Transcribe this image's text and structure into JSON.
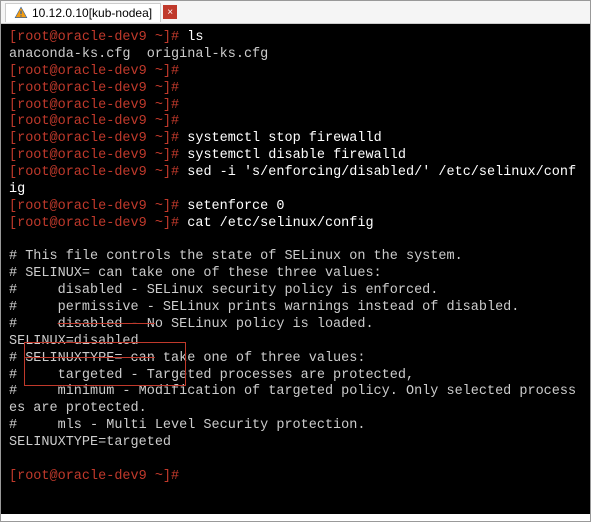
{
  "tab": {
    "title": "10.12.0.10[kub-nodea]",
    "close": "×"
  },
  "term": {
    "p1": "[root@oracle-dev9 ~]#",
    "ls": "ls",
    "lsout": "anaconda-ks.cfg  original-ks.cfg",
    "stop": "systemctl stop firewalld",
    "disable": "systemctl disable firewalld",
    "sed": "sed -i 's/enforcing/disabled/' /etc/selinux/config",
    "setenforce": "setenforce 0",
    "cat": "cat /etc/selinux/config",
    "cfg1": "# This file controls the state of SELinux on the system.",
    "cfg2": "# SELINUX= can take one of these three values:",
    "cfg3": "#     disabled - SELinux security policy is enforced.",
    "cfg4": "#     permissive - SELinux prints warnings instead of disabled.",
    "cfg5a": "#     ",
    "cfg5b": "disabled - N",
    "cfg5c": "o SELinux policy is loaded.",
    "cfg6": "SELINUX=disabled",
    "cfg7a": "# ",
    "cfg7b": "SELINUXTYPE= can",
    "cfg7c": " take one of three values:",
    "cfg8": "#     targeted - Targeted processes are protected,",
    "cfg9": "#     minimum - Modification of targeted policy. Only selected processes are protected.",
    "cfg10": "#     mls - Multi Level Security protection.",
    "cfg11": "SELINUXTYPE=targeted"
  }
}
